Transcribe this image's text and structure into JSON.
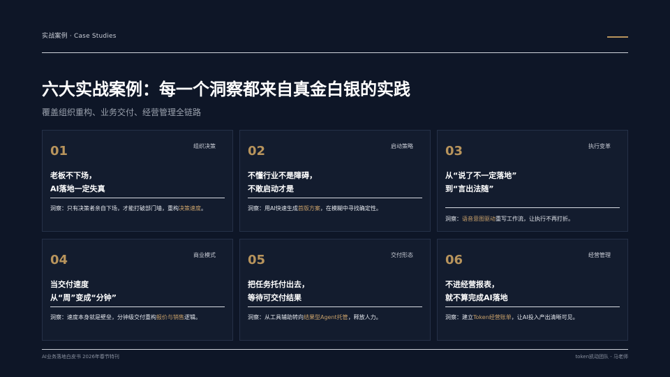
{
  "header": {
    "section_label": "实战案例 · Case Studies"
  },
  "title": "六大实战案例：每一个洞察都来自真金白银的实践",
  "subtitle": "覆盖组织重构、业务交付、经营管理全链路",
  "colors": {
    "background": "#0e1627",
    "card": "#131c2e",
    "accent": "#b8945c",
    "highlight": "#c9a16a"
  },
  "cards": [
    {
      "number": "01",
      "tag": "组织决策",
      "line1": "老板不下场，",
      "line2": "AI落地一定失真",
      "insight_pre": "洞察：只有决策者亲自下场，才能打破部门墙，重构",
      "insight_hl": "决策速度",
      "insight_post": "。"
    },
    {
      "number": "02",
      "tag": "启动策略",
      "line1": "不懂行业不是障碍，",
      "line2": "不敢启动才是",
      "insight_pre": "洞察：用AI快速生成",
      "insight_hl": "首版方案",
      "insight_post": "，在模糊中寻找确定性。"
    },
    {
      "number": "03",
      "tag": "执行变革",
      "line1": "从“说了不一定落地”",
      "line2": "到“言出法随”",
      "insight_pre": "洞察：",
      "insight_hl": "语音意图驱动",
      "insight_post": "重写工作流，让执行不再打折。"
    },
    {
      "number": "04",
      "tag": "商业模式",
      "line1": "当交付速度",
      "line2": "从“周”变成“分钟”",
      "insight_pre": "洞察：速度本身就是壁垒，分钟级交付重构",
      "insight_hl": "报价与销售",
      "insight_post": "逻辑。"
    },
    {
      "number": "05",
      "tag": "交付形态",
      "line1": "把任务托付出去，",
      "line2": "等待可交付结果",
      "insight_pre": "洞察：从工具辅助转向",
      "insight_hl": "结果型Agent托管",
      "insight_post": "，释放人力。"
    },
    {
      "number": "06",
      "tag": "经营管理",
      "line1": "不进经营报表，",
      "line2": "就不算完成AI落地",
      "insight_pre": "洞察：建立",
      "insight_hl": "Token经营账单",
      "insight_post": "，让AI投入产出清晰可见。"
    }
  ],
  "footer": {
    "left": "AI业务落地白皮书 2026年春节特刊",
    "right": "token凯动团队 - 马老师"
  }
}
